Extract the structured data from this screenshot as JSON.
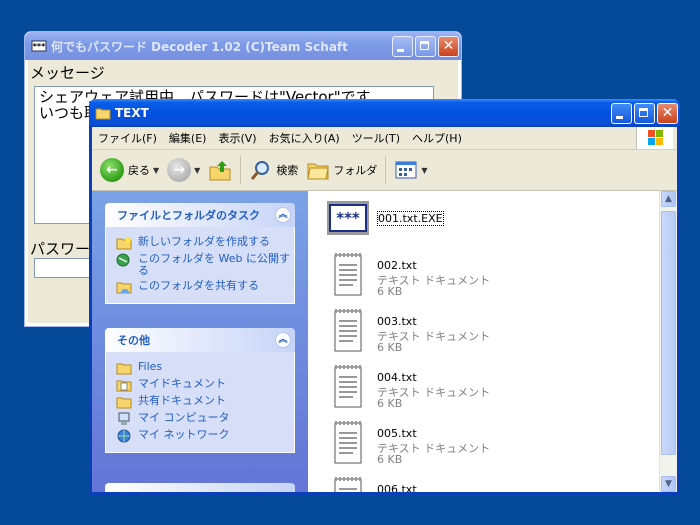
{
  "decoder_window": {
    "title": "何でもパスワード Decoder 1.02 (C)Team Schaft",
    "message_label": "メッセージ",
    "message_text": "シェアウェア試用中　パスワードは\"Vector\"です\nいつも取",
    "password_label": "パスワー"
  },
  "explorer_window": {
    "title": "TEXT",
    "menu": [
      "ファイル(F)",
      "編集(E)",
      "表示(V)",
      "お気に入り(A)",
      "ツール(T)",
      "ヘルプ(H)"
    ],
    "toolbar": {
      "back_label": "戻る",
      "search_label": "検索",
      "folders_label": "フォルダ"
    },
    "tasks_panel": {
      "title": "ファイルとフォルダのタスク",
      "items": [
        "新しいフォルダを作成する",
        "このフォルダを Web に公開する",
        "このフォルダを共有する"
      ]
    },
    "other_panel": {
      "title": "その他",
      "items": [
        "Files",
        "マイドキュメント",
        "共有ドキュメント",
        "マイ コンピュータ",
        "マイ ネットワーク"
      ]
    },
    "files": [
      {
        "name": "001.txt.EXE",
        "type": "",
        "size": ""
      },
      {
        "name": "002.txt",
        "type": "テキスト ドキュメント",
        "size": "6 KB"
      },
      {
        "name": "003.txt",
        "type": "テキスト ドキュメント",
        "size": "6 KB"
      },
      {
        "name": "004.txt",
        "type": "テキスト ドキュメント",
        "size": "6 KB"
      },
      {
        "name": "005.txt",
        "type": "テキスト ドキュメント",
        "size": "6 KB"
      },
      {
        "name": "006.txt",
        "type": "",
        "size": ""
      }
    ]
  },
  "colors": {
    "desktop": "#054a98",
    "titlebar_active": "#0a5ee8",
    "task_link": "#215dc6"
  }
}
